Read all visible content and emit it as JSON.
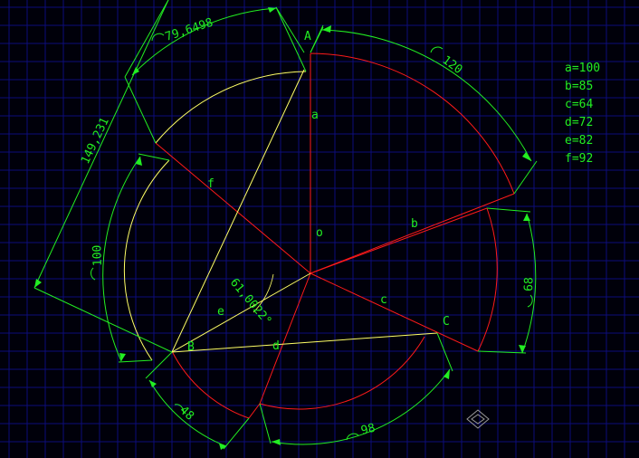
{
  "colors": {
    "background": "#00000a",
    "grid": "#0d0d7a",
    "red": "#ff1a1a",
    "yellow": "#ffff66",
    "green": "#22ee22"
  },
  "points": {
    "A": "A",
    "B": "B",
    "C": "C",
    "O": "o"
  },
  "segments": {
    "a": "a",
    "b": "b",
    "c": "c",
    "d": "d",
    "e": "e",
    "f": "f"
  },
  "dimensions": {
    "arc_a": "120",
    "arc_b": "68",
    "arc_c": "98",
    "arc_d": "48",
    "arc_e": "100",
    "chord_ab": "79,6498",
    "length_af": "149,231",
    "angle_e": "61,0022°"
  },
  "legend": [
    "a=100",
    "b=85",
    "c=64",
    "d=72",
    "e=82",
    "f=92"
  ],
  "corner_icon": "cad-snap-icon"
}
